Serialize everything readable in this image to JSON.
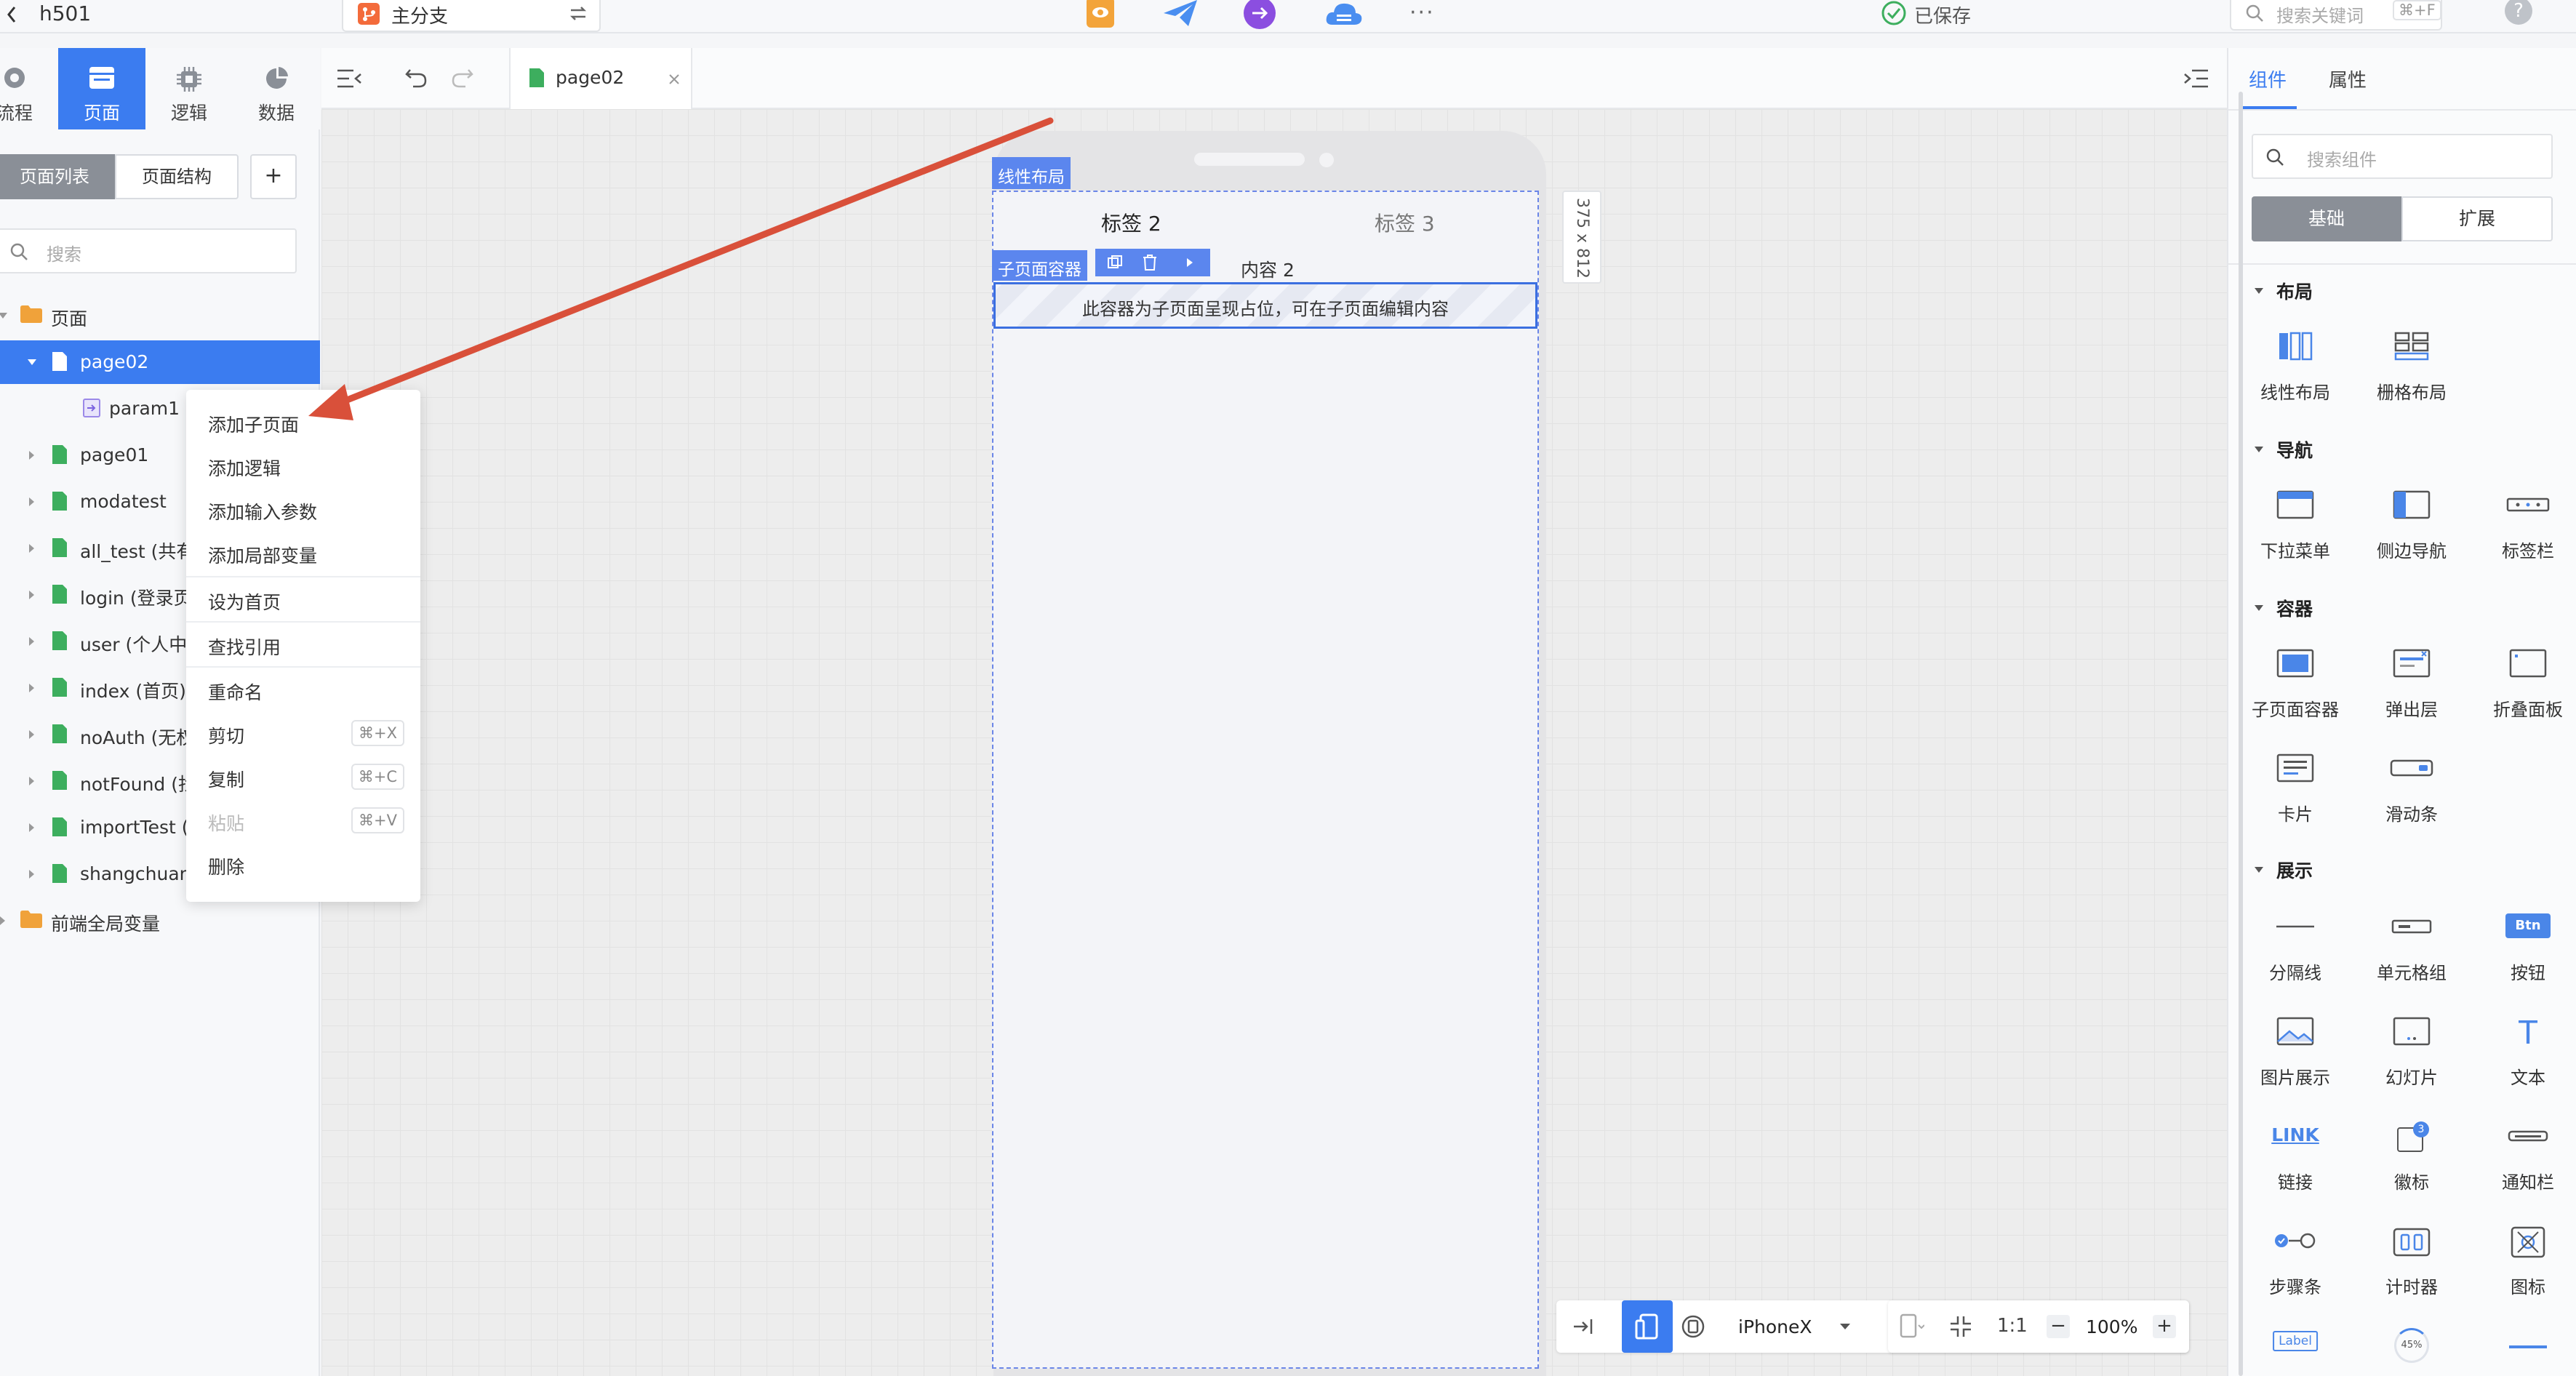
{
  "topbar": {
    "project_name": "h501",
    "branch_label": "主分支",
    "saved_status": "已保存",
    "search_placeholder": "搜索关键词",
    "search_shortcut": "⌘+F",
    "more_label": "···",
    "help_label": "?"
  },
  "left_nav": {
    "tabs": [
      {
        "label": "流程",
        "icon": "flow-icon"
      },
      {
        "label": "页面",
        "icon": "page-icon",
        "active": true
      },
      {
        "label": "逻辑",
        "icon": "logic-icon"
      },
      {
        "label": "数据",
        "icon": "data-icon"
      }
    ]
  },
  "left_panel": {
    "tab_page_list": "页面列表",
    "tab_page_structure": "页面结构",
    "add_label": "+",
    "search_placeholder": "搜索",
    "tree": [
      {
        "label": "页面",
        "type": "folder",
        "level": 0,
        "expanded": true
      },
      {
        "label": "page02",
        "type": "page",
        "level": 1,
        "expanded": true,
        "selected": true
      },
      {
        "label": "param1",
        "type": "param",
        "level": 2
      },
      {
        "label": "page01",
        "type": "page",
        "level": 1
      },
      {
        "label": "modatest",
        "type": "page",
        "level": 1
      },
      {
        "label": "all_test (共有",
        "type": "page",
        "level": 1
      },
      {
        "label": "login (登录页",
        "type": "page",
        "level": 1
      },
      {
        "label": "user (个人中心",
        "type": "page",
        "level": 1
      },
      {
        "label": "index (首页)",
        "type": "page",
        "level": 1
      },
      {
        "label": "noAuth (无权",
        "type": "page",
        "level": 1
      },
      {
        "label": "notFound (找",
        "type": "page",
        "level": 1
      },
      {
        "label": "importTest (",
        "type": "page",
        "level": 1
      },
      {
        "label": "shangchuan (",
        "type": "page",
        "level": 1
      },
      {
        "label": "前端全局变量",
        "type": "folder",
        "level": 0
      }
    ]
  },
  "context_menu": {
    "items": [
      {
        "label": "添加子页面"
      },
      {
        "label": "添加逻辑"
      },
      {
        "label": "添加输入参数"
      },
      {
        "label": "添加局部变量"
      },
      {
        "label": "设为首页"
      },
      {
        "label": "查找引用"
      },
      {
        "label": "重命名"
      },
      {
        "label": "剪切",
        "shortcut": "⌘+X"
      },
      {
        "label": "复制",
        "shortcut": "⌘+C"
      },
      {
        "label": "粘贴",
        "shortcut": "⌘+V",
        "disabled": true
      },
      {
        "label": "删除"
      }
    ]
  },
  "editor": {
    "tab_name": "page02",
    "linear_layout_label": "线性布局",
    "tabs": [
      "标签 2",
      "标签 3"
    ],
    "subpage_container_label": "子页面容器",
    "content_label": "内容 2",
    "placeholder_text": "此容器为子页面呈现占位，可在子页面编辑内容",
    "size_label": "375 x 812",
    "device": "iPhoneX",
    "ratio_label": "1:1",
    "zoom": "100%",
    "zoom_minus": "−",
    "zoom_plus": "+"
  },
  "right_panel": {
    "tab_components": "组件",
    "tab_properties": "属性",
    "search_placeholder": "搜索组件",
    "seg_basic": "基础",
    "seg_extend": "扩展",
    "sections": {
      "layout": "布局",
      "nav": "导航",
      "container": "容器",
      "display": "展示"
    },
    "components": {
      "linear_layout": "线性布局",
      "grid_layout": "栅格布局",
      "dropdown": "下拉菜单",
      "side_nav": "侧边导航",
      "tab_bar": "标签栏",
      "subpage_container": "子页面容器",
      "popup": "弹出层",
      "collapse": "折叠面板",
      "card": "卡片",
      "slider": "滑动条",
      "divider": "分隔线",
      "cell_group": "单元格组",
      "button": "按钮",
      "image": "图片展示",
      "carousel": "幻灯片",
      "text": "文本",
      "link": "链接",
      "badge": "徽标",
      "notice_bar": "通知栏",
      "steps": "步骤条",
      "counter": "计时器",
      "icon": "图标"
    },
    "icon_texts": {
      "btn": "Btn",
      "link": "LINK",
      "text_t": "T",
      "badge_num": "3",
      "label": "Label",
      "progress": "45%"
    }
  },
  "colors": {
    "accent": "#3b7cf0",
    "annotation_arrow": "#d9503a",
    "file_green": "#3dae5e",
    "folder_orange": "#f0a23a"
  }
}
